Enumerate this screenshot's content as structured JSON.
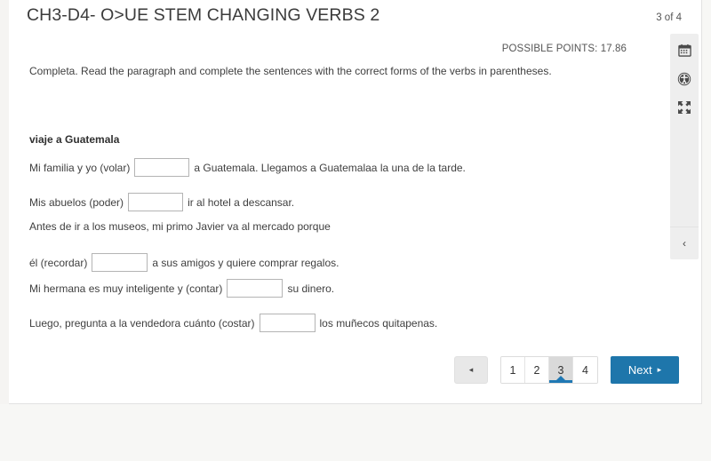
{
  "header": {
    "title": "CH3-D4- O>UE STEM CHANGING VERBS 2",
    "page_counter": "3 of 4",
    "possible_points": "POSSIBLE POINTS: 17.86"
  },
  "instructions": "Completa. Read the paragraph and complete the sentences with the correct forms of the verbs in parentheses.",
  "exercise": {
    "heading": "viaje a Guatemala",
    "lines": [
      {
        "pre": "Mi familia y yo (volar)",
        "input_value": "",
        "post": "a Guatemala. Llegamos a Guatemalaa la una de la tarde."
      },
      {
        "pre": "Mis abuelos (poder)",
        "input_value": "",
        "post": "ir al hotel a descansar."
      },
      {
        "pre": "Antes de ir a los museos, mi primo Javier va al mercado porque",
        "input_value": null,
        "post": ""
      },
      {
        "pre": "él (recordar)",
        "input_value": "",
        "post": "a sus amigos y quiere comprar regalos."
      },
      {
        "pre": "Mi hermana es muy inteligente y (contar)",
        "input_value": "",
        "post": "su dinero."
      },
      {
        "pre": "Luego, pregunta a la vendedora cuánto (costar)",
        "input_value": "",
        "post": "los muñecos quitapenas."
      }
    ]
  },
  "tools": {
    "calendar_icon": "calendar-icon",
    "accessibility_icon": "accessibility-icon",
    "fullscreen_icon": "fullscreen-icon",
    "collapse_icon": "chevron-left-icon",
    "collapse_label": "‹"
  },
  "pagination": {
    "prev_label": "◂",
    "pages": [
      "1",
      "2",
      "3",
      "4"
    ],
    "active_page": "3",
    "next_label": "Next",
    "next_arrow": "▸",
    "accent_color": "#1e76ab",
    "active_underline_color": "#1f78b4"
  }
}
